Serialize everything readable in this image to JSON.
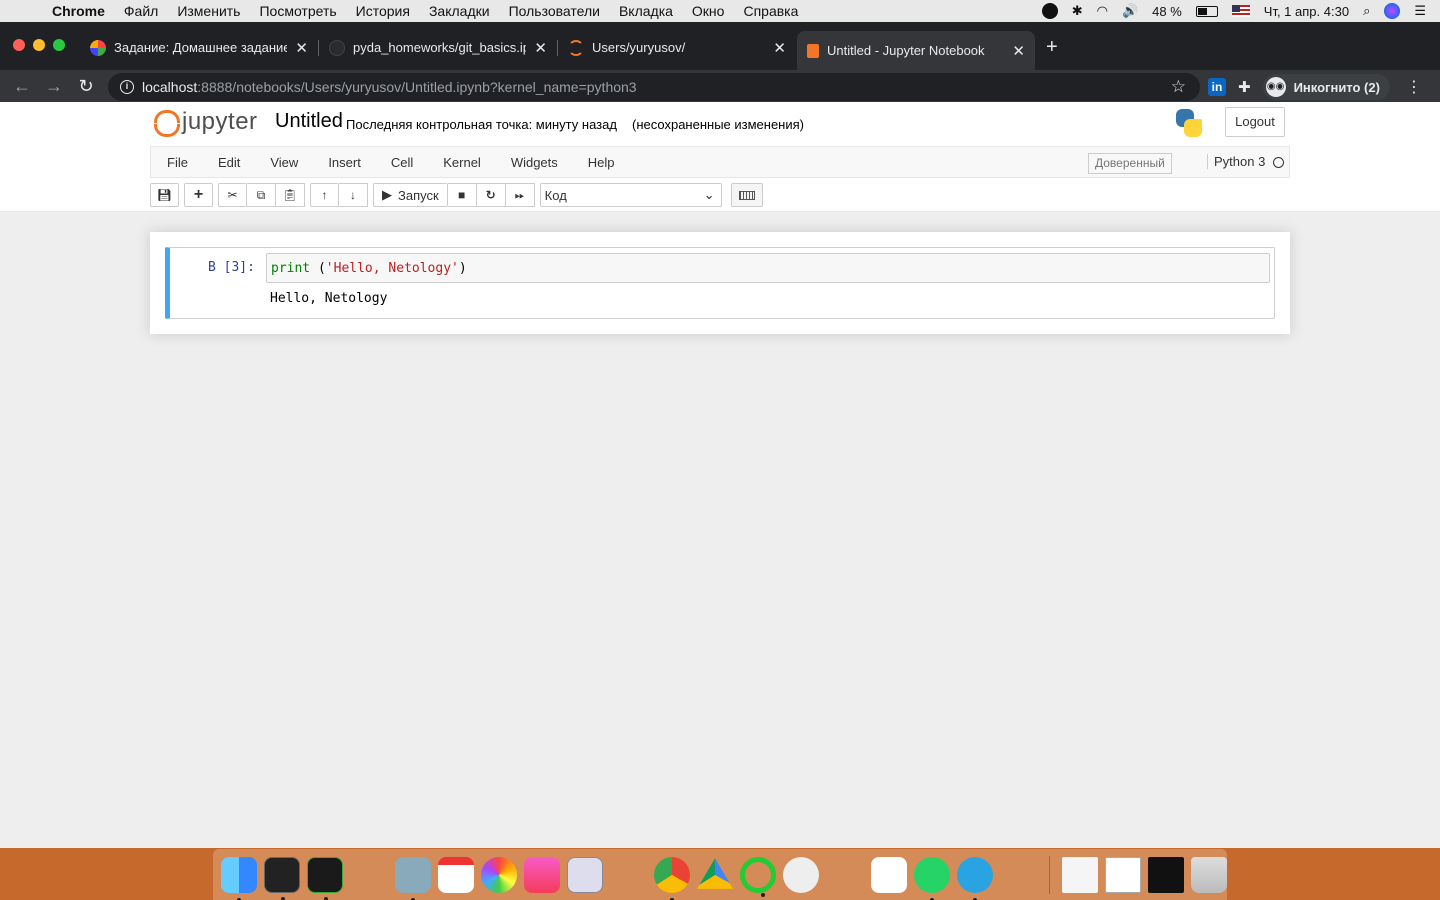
{
  "menubar": {
    "app_name": "Chrome",
    "items": [
      "Файл",
      "Изменить",
      "Посмотреть",
      "История",
      "Закладки",
      "Пользователи",
      "Вкладка",
      "Окно",
      "Справка"
    ],
    "battery": "48 %",
    "datetime": "Чт, 1 апр.  4:30"
  },
  "tabs": [
    {
      "title": "Задание: Домашнее задание",
      "icon": "colorful-favicon"
    },
    {
      "title": "pyda_homeworks/git_basics.ip",
      "icon": "github-favicon"
    },
    {
      "title": "Users/yuryusov/",
      "icon": "jupyter-favicon"
    },
    {
      "title": "Untitled - Jupyter Notebook",
      "icon": "notebook-favicon",
      "active": true
    }
  ],
  "omnibox": {
    "host": "localhost",
    "path": ":8888/notebooks/Users/yuryusov/Untitled.ipynb?kernel_name=python3"
  },
  "profile": {
    "label": "Инкогнито (2)"
  },
  "jupyter": {
    "logo_text": "jupyter",
    "notebook_name": "Untitled",
    "checkpoint": "Последняя контрольная точка: минуту назад",
    "autosave": "(несохраненные изменения)",
    "logout": "Logout",
    "menu": [
      "File",
      "Edit",
      "View",
      "Insert",
      "Cell",
      "Kernel",
      "Widgets",
      "Help"
    ],
    "trusted": "Доверенный",
    "kernel": "Python 3",
    "run_label": "Запуск",
    "cell_type": "Код"
  },
  "cell": {
    "prompt": "В [3]:",
    "code_func": "print",
    "code_open": " (",
    "code_string": "'Hello, Netology'",
    "code_close": ")",
    "output": "Hello, Netology"
  },
  "colors": {
    "accent_blue": "#42a5f5",
    "jupyter_orange": "#f37626",
    "chrome_dark": "#202124"
  }
}
